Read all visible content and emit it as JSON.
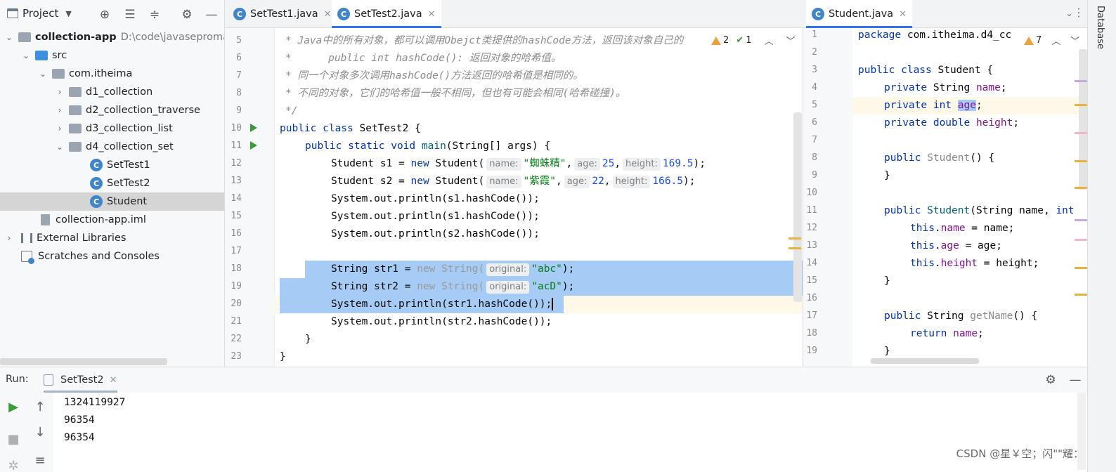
{
  "project_panel": {
    "title": "Project",
    "tree": [
      {
        "label": "collection-app",
        "path": "D:\\code\\javasepromax"
      },
      {
        "label": "src"
      },
      {
        "label": "com.itheima"
      },
      {
        "label": "d1_collection"
      },
      {
        "label": "d2_collection_traverse"
      },
      {
        "label": "d3_collection_list"
      },
      {
        "label": "d4_collection_set"
      },
      {
        "label": "SetTest1"
      },
      {
        "label": "SetTest2"
      },
      {
        "label": "Student"
      },
      {
        "label": "collection-app.iml"
      },
      {
        "label": "External Libraries"
      },
      {
        "label": "Scratches and Consoles"
      }
    ]
  },
  "main_tabs": [
    {
      "label": "SetTest1.java"
    },
    {
      "label": "SetTest2.java"
    }
  ],
  "side_tabs": [
    {
      "label": "Student.java"
    }
  ],
  "main_editor": {
    "inspections": {
      "warnings": "2",
      "typos": "1"
    },
    "line_numbers": [
      "5",
      "6",
      "7",
      "8",
      "9",
      "10",
      "11",
      "12",
      "13",
      "14",
      "15",
      "16",
      "17",
      "18",
      "19",
      "20",
      "21",
      "22",
      "23"
    ],
    "lines": {
      "l5": "* Java中的所有对象，都可以调用Obejct类提供的hashCode方法，返回该对象自己的",
      "l6": "*      public int hashCode(): 返回对象的哈希值。",
      "l7": "* 同一个对象多次调用hashCode()方法返回的哈希值是相同的。",
      "l8": "* 不同的对象，它们的哈希值一般不相同，但也有可能会相同(哈希碰撞)。",
      "l9": "*/",
      "l10_kw": "public class",
      "l10_rest": " SetTest2 {",
      "l11_kw": "public static void",
      "l11_fn": "main",
      "l11_rest": "(String[] args) {",
      "l12_a": "Student s1 = ",
      "l12_new": "new",
      "l12_b": " Student(",
      "l12_h1": "name:",
      "l12_s1": "\"蜘蛛精\"",
      "l12_c": ",",
      "l12_h2": "age:",
      "l12_n1": "25",
      "l12_d": ",",
      "l12_h3": "height:",
      "l12_n2": "169.5",
      "l12_e": ");",
      "l13_a": "Student s2 = ",
      "l13_new": "new",
      "l13_b": " Student(",
      "l13_h1": "name:",
      "l13_s1": "\"紫霞\"",
      "l13_c": ",",
      "l13_h2": "age:",
      "l13_n1": "22",
      "l13_d": ",",
      "l13_h3": "height:",
      "l13_n2": "166.5",
      "l13_e": ");",
      "l14": "System.out.println(s1.hashCode());",
      "l15": "System.out.println(s1.hashCode());",
      "l16": "System.out.println(s2.hashCode());",
      "l18_a": "String str1 = ",
      "l18_new": "new String(",
      "l18_h": "original:",
      "l18_s": "\"abc\"",
      "l18_e": ");",
      "l19_a": "String str2 = ",
      "l19_new": "new String(",
      "l19_h": "original:",
      "l19_s": "\"acD\"",
      "l19_e": ");",
      "l20": "System.out.println(str1.hashCode());",
      "l21": "System.out.println(str2.hashCode());",
      "l22": "}",
      "l23": "}"
    }
  },
  "side_editor": {
    "inspections": {
      "warnings": "7"
    },
    "line_numbers": [
      "1",
      "2",
      "3",
      "4",
      "5",
      "6",
      "7",
      "8",
      "9",
      "10",
      "11",
      "12",
      "13",
      "14",
      "15",
      "16",
      "17",
      "18",
      "19"
    ],
    "lines": {
      "l1_kw": "package",
      "l1_rest": " com.itheima.d4_cc",
      "l3_kw": "public class",
      "l3_rest": " Student {",
      "l4_kw": "private",
      "l4_rest": " String ",
      "l4_f": "name",
      "l5_kw": "private int",
      "l5_f": "age",
      "l6_kw": "private double",
      "l6_f": "height",
      "l8_kw": "public",
      "l8_fn": "Student",
      "l8_rest": "() {",
      "l9": "}",
      "l11_kw": "public",
      "l11_fn": "Student",
      "l11_rest": "(String name, ",
      "l11_end": "int",
      "l12_this": "this",
      "l12_f": "name",
      "l12_rest": " = name;",
      "l13_this": "this",
      "l13_f": "age",
      "l13_rest": " = age;",
      "l14_this": "this",
      "l14_f": "height",
      "l14_rest": " = height;",
      "l15": "}",
      "l17_kw": "public",
      "l17_rest": " String ",
      "l17_fn": "getName",
      "l17_end": "() {",
      "l18_kw": "return",
      "l18_f": "name",
      "l19": "}"
    }
  },
  "right_strip": {
    "label": "Database"
  },
  "run_panel": {
    "label": "Run:",
    "tab": "SetTest2",
    "output": [
      "1324119927",
      "96354",
      "96354"
    ]
  },
  "watermark": "CSDN @星￥空；闪\"\"耀："
}
